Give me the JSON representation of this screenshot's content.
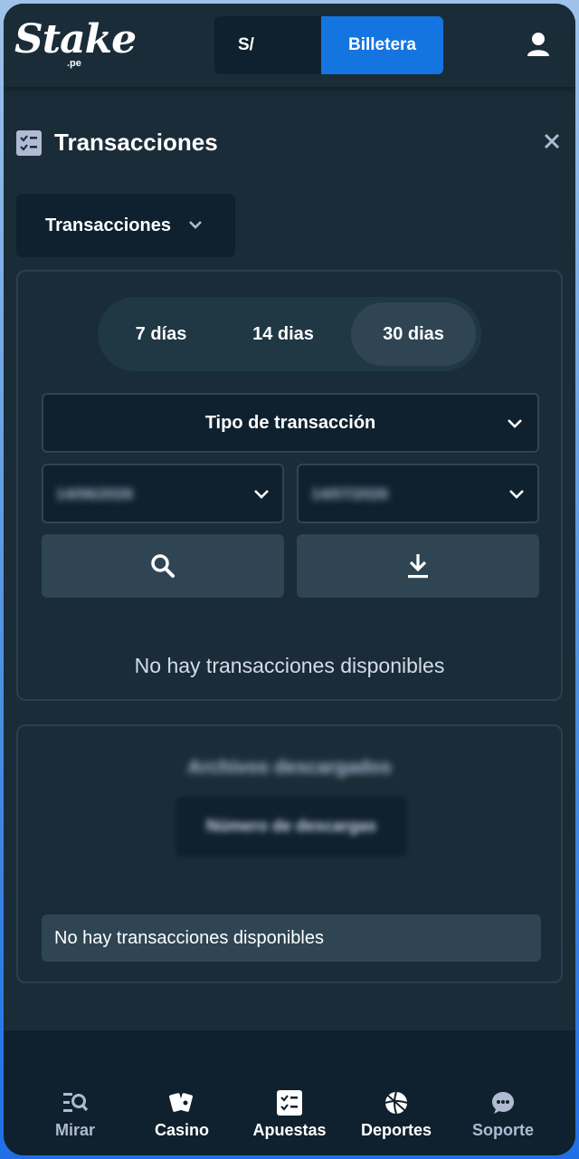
{
  "header": {
    "logo_text": "Stake",
    "logo_sub": ".pe",
    "currency": "S/",
    "wallet_label": "Billetera",
    "user_icon": "user-icon"
  },
  "page": {
    "title": "Transacciones",
    "title_icon": "checklist-icon",
    "close_icon": "close-icon",
    "category_dropdown": "Transacciones"
  },
  "filters": {
    "periods": [
      "7 días",
      "14 dias",
      "30 dias"
    ],
    "selected_period": "30 dias",
    "transaction_type_label": "Tipo de transacción",
    "date_from": "14/06/2026",
    "date_to": "14/07/2026",
    "search_icon": "search-icon",
    "download_icon": "download-icon"
  },
  "results": {
    "empty_message": "No hay transacciones disponibles"
  },
  "downloads": {
    "title": "Archivos descargados",
    "count_button": "Número de descargas",
    "empty_message": "No hay transacciones disponibles"
  },
  "bottom_nav": [
    {
      "label": "Mirar",
      "icon": "browse-icon",
      "active": false
    },
    {
      "label": "Casino",
      "icon": "cards-icon",
      "active": true
    },
    {
      "label": "Apuestas",
      "icon": "bets-icon",
      "active": true
    },
    {
      "label": "Deportes",
      "icon": "sports-ball-icon",
      "active": true
    },
    {
      "label": "Soporte",
      "icon": "chat-icon",
      "active": false
    }
  ],
  "colors": {
    "background": "#1a2c38",
    "dark": "#0f212e",
    "accent": "#1475e1",
    "panel_border": "#2b3f4c",
    "button": "#2f4553"
  }
}
